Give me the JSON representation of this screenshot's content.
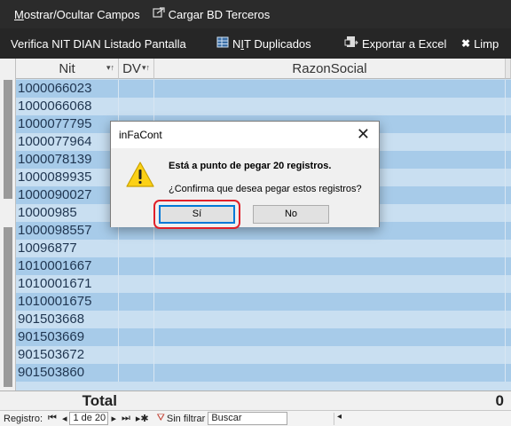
{
  "toolbar1": {
    "mostrar_label_u": "M",
    "mostrar_label_rest": "ostrar/Ocultar Campos",
    "cargar_label": "Cargar BD Terceros"
  },
  "toolbar2": {
    "verifica_label": "Verifica NIT DIAN Listado Pantalla",
    "duplicados_label_pre": "N",
    "duplicados_label_u": "I",
    "duplicados_label_rest": "T Duplicados",
    "exportar_label": "Exportar a Excel",
    "limpiar_label": "Limp"
  },
  "grid": {
    "columns": {
      "nit": "Nit",
      "dv": "DV",
      "razon": "RazonSocial"
    },
    "rows": [
      "1000066023",
      "1000066068",
      "1000077795",
      "1000077964",
      "1000078139",
      "1000089935",
      "1000090027",
      "10000985",
      "1000098557",
      "10096877",
      "1010001667",
      "1010001671",
      "1010001675",
      "901503668",
      "901503669",
      "901503672",
      "901503860"
    ]
  },
  "totals": {
    "label": "Total",
    "value": "0"
  },
  "navbar": {
    "registro_label": "Registro:",
    "position": "1 de 20",
    "filter_label": "Sin filtrar",
    "search_placeholder": "Buscar"
  },
  "dialog": {
    "title": "inFaCont",
    "message": "Está a punto de pegar 20 registros.",
    "question": "¿Confirma que desea pegar estos registros?",
    "yes": "Sí",
    "no": "No",
    "close": "✕"
  }
}
